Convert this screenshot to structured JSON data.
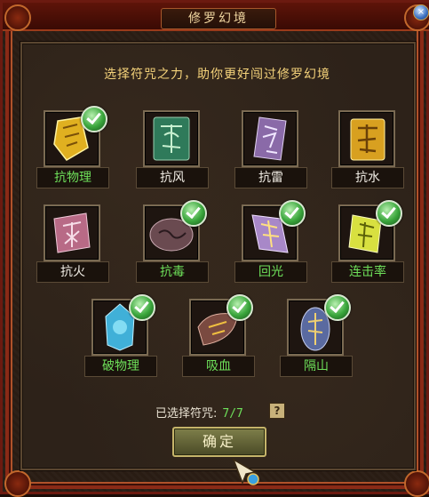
{
  "window": {
    "title": "修罗幻境"
  },
  "instruction": "选择符咒之力，助你更好闯过修罗幻境",
  "talismans": [
    {
      "label": "抗物理",
      "selected": true,
      "icon": "shield-flame-talisman-icon",
      "color": "#e0b020"
    },
    {
      "label": "抗风",
      "selected": false,
      "icon": "wind-talisman-icon",
      "color": "#2f7a5a"
    },
    {
      "label": "抗雷",
      "selected": false,
      "icon": "thunder-talisman-icon",
      "color": "#8a6aa8"
    },
    {
      "label": "抗水",
      "selected": false,
      "icon": "water-talisman-icon",
      "color": "#d8a020"
    },
    {
      "label": "抗火",
      "selected": false,
      "icon": "fire-talisman-icon",
      "color": "#b86a86"
    },
    {
      "label": "抗毒",
      "selected": true,
      "icon": "poison-talisman-icon",
      "color": "#6a4a50"
    },
    {
      "label": "回光",
      "selected": true,
      "icon": "light-talisman-icon",
      "color": "#a888c8"
    },
    {
      "label": "连击率",
      "selected": true,
      "icon": "combo-talisman-icon",
      "color": "#d8e040"
    },
    {
      "label": "破物理",
      "selected": true,
      "icon": "break-talisman-icon",
      "color": "#40b0d8"
    },
    {
      "label": "吸血",
      "selected": true,
      "icon": "lifesteal-talisman-icon",
      "color": "#7a4a40"
    },
    {
      "label": "隔山",
      "selected": true,
      "icon": "mountain-talisman-icon",
      "color": "#5a6aa0"
    }
  ],
  "status": {
    "label": "已选择符咒:",
    "count": "7/7",
    "help": "?"
  },
  "confirm_label": "确定"
}
